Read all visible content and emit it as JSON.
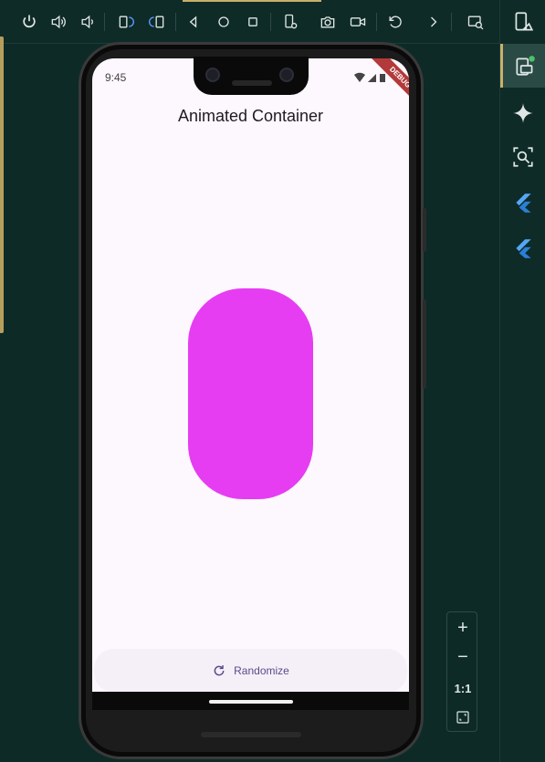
{
  "emulator": {
    "toolbar": {
      "buttons": [
        {
          "name": "power-button",
          "icon": "power-icon"
        },
        {
          "name": "volume-up-button",
          "icon": "volume-up-icon"
        },
        {
          "name": "volume-down-button",
          "icon": "volume-down-icon"
        },
        {
          "name": "rotate-left-button",
          "icon": "rotate-left-icon"
        },
        {
          "name": "rotate-right-button",
          "icon": "rotate-right-icon"
        },
        {
          "name": "back-button",
          "icon": "back-triangle-icon"
        },
        {
          "name": "home-button",
          "icon": "home-circle-icon"
        },
        {
          "name": "overview-button",
          "icon": "overview-square-icon"
        },
        {
          "name": "device-settings-button",
          "icon": "device-gear-icon"
        },
        {
          "name": "screenshot-button",
          "icon": "camera-icon"
        },
        {
          "name": "record-button",
          "icon": "video-camera-icon"
        },
        {
          "name": "undo-button",
          "icon": "undo-icon"
        },
        {
          "name": "more-button",
          "icon": "chevron-right-icon"
        },
        {
          "name": "device-explorer-button",
          "icon": "search-window-icon"
        }
      ]
    },
    "rail": {
      "items": [
        {
          "name": "device-manager",
          "icon": "device-manager-icon"
        },
        {
          "name": "running-devices",
          "icon": "running-device-icon"
        },
        {
          "name": "gemini",
          "icon": "sparkle-icon"
        },
        {
          "name": "layout-inspector",
          "icon": "layout-inspector-icon"
        },
        {
          "name": "flutter-inspector",
          "icon": "flutter-icon"
        },
        {
          "name": "flutter-performance",
          "icon": "flutter-icon"
        }
      ]
    },
    "zoom": {
      "zoom_in": "+",
      "zoom_out": "−",
      "actual_size": "1:1",
      "fit_icon": "fit-screen-icon"
    }
  },
  "device": {
    "status_time": "9:45",
    "debug_banner": "DEBUG",
    "app": {
      "title": "Animated Container",
      "container_color": "#e63df2",
      "button_label": "Randomize",
      "button_icon": "refresh-icon"
    }
  }
}
